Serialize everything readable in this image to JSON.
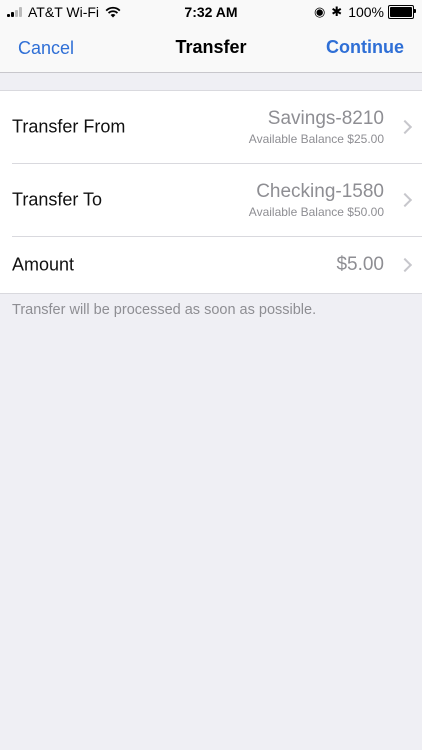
{
  "status_bar": {
    "carrier": "AT&T Wi-Fi",
    "time": "7:32 AM",
    "battery": "100%",
    "battery_level": 1.0
  },
  "nav": {
    "cancel_label": "Cancel",
    "title": "Transfer",
    "continue_label": "Continue"
  },
  "form": {
    "rows": [
      {
        "label": "Transfer From",
        "value": "Savings-8210",
        "sub": "Available Balance $25.00"
      },
      {
        "label": "Transfer To",
        "value": "Checking-1580",
        "sub": "Available Balance $50.00"
      },
      {
        "label": "Amount",
        "value": "$5.00"
      }
    ]
  },
  "note": "Transfer will be processed as soon as possible.",
  "colors": {
    "accent": "#2f6fd6",
    "background": "#efeff4",
    "secondary_text": "#8e8e93"
  }
}
